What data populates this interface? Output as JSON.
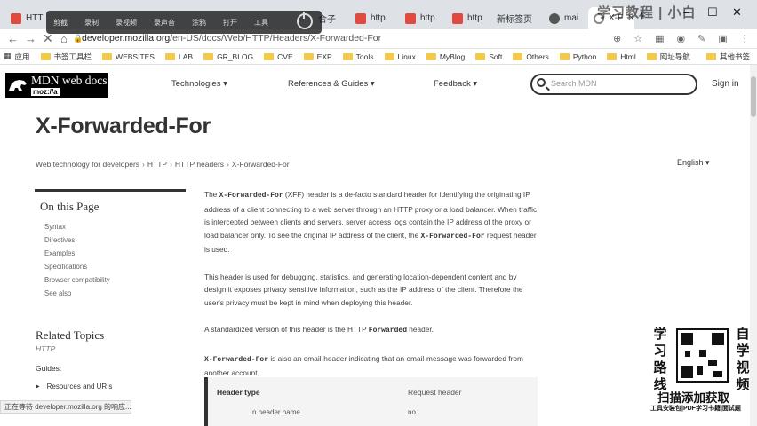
{
  "browser": {
    "tabs": [
      {
        "label": "HTT",
        "active": false,
        "favicon_color": "#e04a3f"
      },
      {
        "label": "合子",
        "active": false,
        "favicon_color": "#f5a623"
      },
      {
        "label": "http",
        "active": false,
        "favicon_color": "#e04a3f"
      },
      {
        "label": "http",
        "active": false,
        "favicon_color": "#e04a3f"
      },
      {
        "label": "http",
        "active": false,
        "favicon_color": "#e04a3f"
      },
      {
        "label": "新标签页",
        "active": false,
        "favicon_color": "#333333"
      },
      {
        "label": "mai",
        "active": false,
        "favicon_color": "#555555"
      },
      {
        "label": "X-F",
        "active": true,
        "favicon_color": "#888888"
      }
    ],
    "overlay_toolbar": [
      "剪截",
      "录制",
      "录视频",
      "录声音",
      "涂鸦",
      "打开",
      "工具"
    ],
    "url": {
      "host": "developer.mozilla.org",
      "path": "/en-US/docs/Web/HTTP/Headers/X-Forwarded-For"
    },
    "bookmarks": [
      "应用",
      "书签工具栏",
      "WEBSITES",
      "LAB",
      "GR_BLOG",
      "CVE",
      "EXP",
      "Tools",
      "Linux",
      "MyBlog",
      "Soft",
      "Others",
      "Python",
      "Html",
      "网址导航"
    ],
    "other_bookmarks": "其他书签",
    "status_text": "正在等待 developer.mozilla.org 的响应..."
  },
  "mdn": {
    "logo": {
      "brand": "MDN web docs",
      "org": "moz://a"
    },
    "nav": [
      "Technologies ▾",
      "References & Guides ▾",
      "Feedback ▾"
    ],
    "search_placeholder": "Search MDN",
    "signin": "Sign in",
    "title": "X-Forwarded-For",
    "breadcrumb": [
      "Web technology for developers",
      "HTTP",
      "HTTP headers",
      "X-Forwarded-For"
    ],
    "language": "English ▾",
    "sidebar": {
      "title": "On this Page",
      "toc": [
        "Syntax",
        "Directives",
        "Examples",
        "Specifications",
        "Browser compatibility",
        "See also"
      ],
      "related_title": "Related Topics",
      "related_sub": "HTTP",
      "guides_label": "Guides:",
      "guide_item": "Resources and URIs"
    },
    "content": {
      "p1_a": "The ",
      "p1_code": "X-Forwarded-For",
      "p1_b": " (XFF) header is a de-facto standard header for identifying the originating IP address of a client connecting to a web server through an HTTP proxy or a load balancer. When traffic is intercepted between clients and servers, server access logs contain the IP address of the proxy or load balancer only. To see the original IP address of the client, the ",
      "p1_code2": "X-Forwarded-For",
      "p1_c": " request header is used.",
      "p2": "This header is used for debugging, statistics, and generating location-dependent content and by design it exposes privacy sensitive information, such as the IP address of the client. Therefore the user's privacy must be kept in mind when deploying this header.",
      "p3_a": "A standardized version of this header is the HTTP ",
      "p3_code": "Forwarded",
      "p3_b": " header.",
      "p4_code": "X-Forwarded-For",
      "p4_b": " is also an email-header indicating that an email-message was forwarded from another account."
    },
    "spec_table": {
      "header_type_label": "Header type",
      "header_type_value": "Request header",
      "forbidden_label": "n header name",
      "forbidden_value": "no"
    }
  },
  "watermark": {
    "top_text": "学习教程 | 小白",
    "left_col": [
      "学",
      "习",
      "路",
      "线"
    ],
    "right_col": [
      "自",
      "学",
      "视",
      "频"
    ],
    "scan": "扫描添加获取",
    "sub": "工具安装包|PDF学习书籍|面试题"
  }
}
